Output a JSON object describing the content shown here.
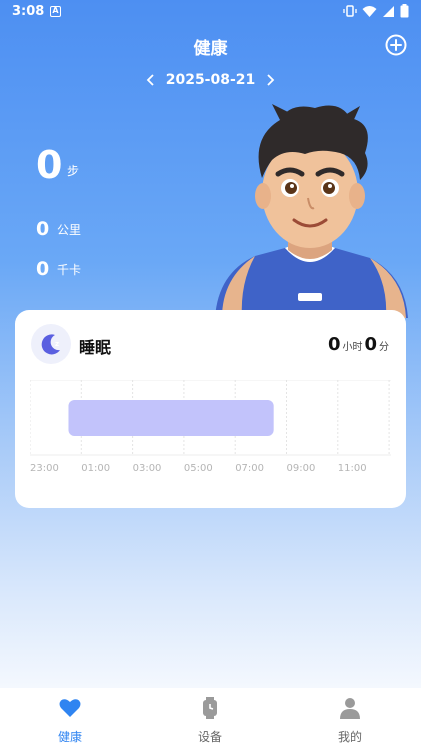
{
  "status_bar": {
    "time": "3:08",
    "notification_letter": "A"
  },
  "header": {
    "title": "健康",
    "add_icon": "plus-circle-icon"
  },
  "date_nav": {
    "date": "2025-08-21",
    "prev_icon": "chevron-left-icon",
    "next_icon": "chevron-right-icon"
  },
  "stats": {
    "steps_value": "0",
    "steps_unit": "步",
    "distance_value": "0",
    "distance_unit": "公里",
    "calories_value": "0",
    "calories_unit": "千卡"
  },
  "sleep_card": {
    "title": "睡眠",
    "icon": "moon-zz-icon",
    "hours_value": "0",
    "hours_unit": "小时",
    "minutes_value": "0",
    "minutes_unit": "分",
    "time_ticks": [
      "23:00",
      "01:00",
      "03:00",
      "05:00",
      "07:00",
      "09:00",
      "11:00"
    ],
    "sleep_bar": {
      "start": "00:30",
      "end": "08:30",
      "color": "#c2c3fb"
    }
  },
  "bottom_nav": {
    "items": [
      {
        "label": "健康",
        "icon": "heart-icon",
        "active": true
      },
      {
        "label": "设备",
        "icon": "watch-icon",
        "active": false
      },
      {
        "label": "我的",
        "icon": "person-icon",
        "active": false
      }
    ]
  },
  "colors": {
    "primary": "#2f84f1",
    "sleep_accent": "#5a5fe0"
  }
}
